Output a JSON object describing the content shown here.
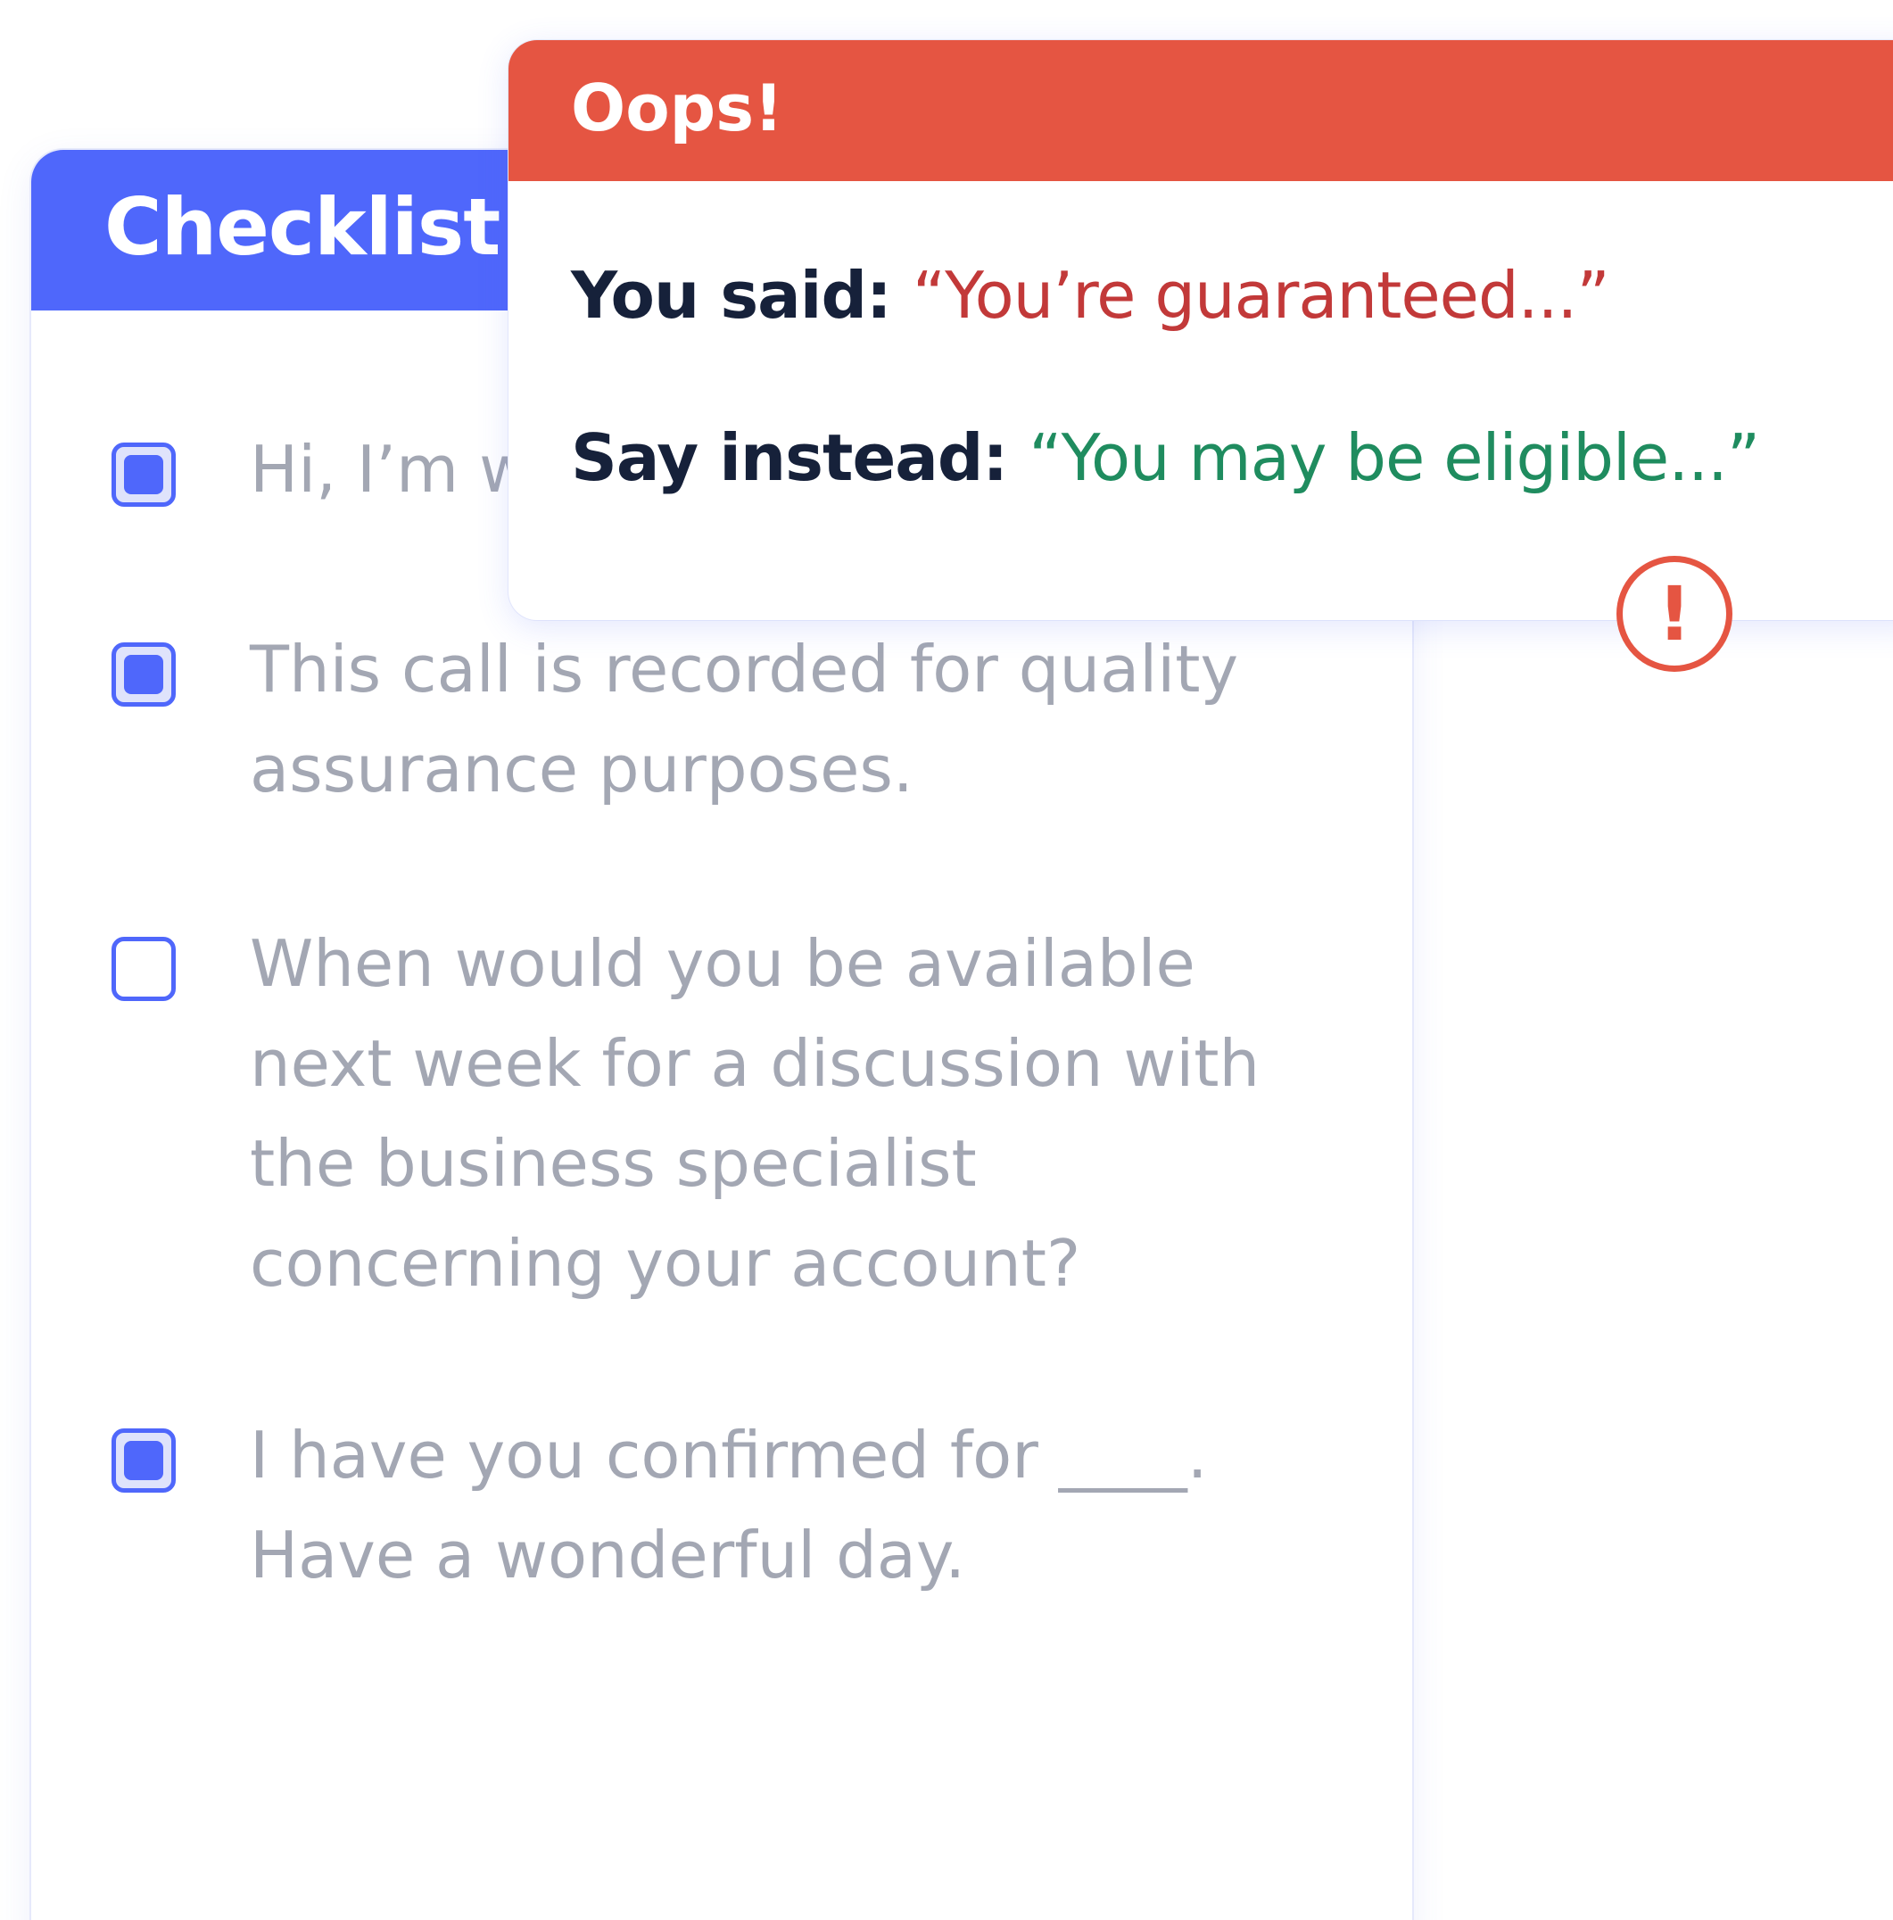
{
  "checklist": {
    "title": "Checklist",
    "items": [
      {
        "text": "Hi, I’m w",
        "checked": true
      },
      {
        "text": "This call is recorded for quality\nassurance purposes.",
        "checked": true
      },
      {
        "text": "When would you be available\nnext week for a discussion with\nthe business specialist\nconcerning your account?",
        "checked": false
      },
      {
        "text": "I have you confirmed for ____.\nHave a wonderful day.",
        "checked": true
      }
    ]
  },
  "alert": {
    "title": "Oops!",
    "said_label": "You said: ",
    "said_quote": "“You’re guaranteed...”",
    "instead_label": "Say instead: ",
    "instead_quote": "“You may be eligible...”",
    "icon": "exclamation-circle-icon",
    "icon_glyph": "!"
  },
  "colors": {
    "accent": "#4f67fb",
    "alert": "#e55542",
    "bad_quote": "#c23939",
    "good_quote": "#1f8c5f",
    "muted_text": "#a3a7b3"
  }
}
